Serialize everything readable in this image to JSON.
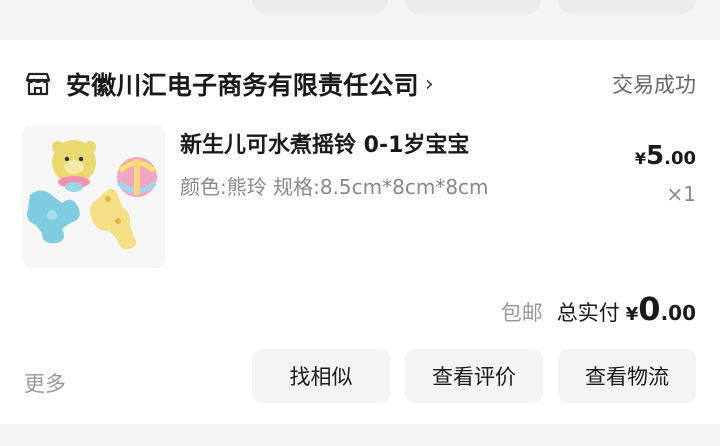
{
  "shop": {
    "name": "安徽川汇电子商务有限责任公司",
    "chevron": "›",
    "icon": "shop-icon",
    "status": "交易成功"
  },
  "product": {
    "title": "新生儿可水煮摇铃 0-1岁宝宝",
    "spec": "颜色:熊玲 规格:8.5cm*8cm*8cm",
    "price": {
      "symbol": "¥",
      "integer": "5",
      "decimal": ".00"
    },
    "quantity": "×1"
  },
  "summary": {
    "shipping": "包邮",
    "total_label": "总实付",
    "total": {
      "symbol": "¥",
      "integer": "0",
      "decimal": ".00"
    }
  },
  "actions": {
    "more": "更多",
    "similar": "找相似",
    "review": "查看评价",
    "logistics": "查看物流"
  }
}
